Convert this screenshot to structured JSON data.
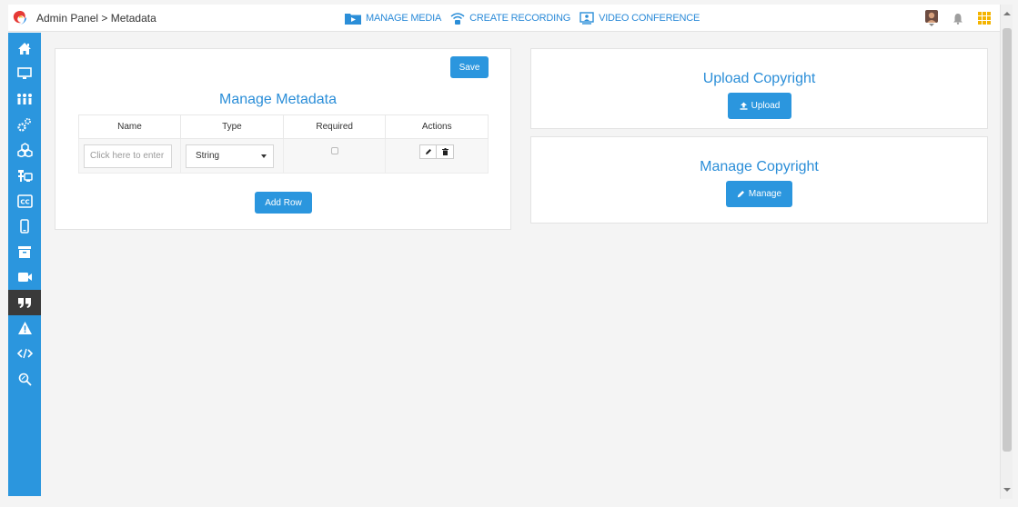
{
  "breadcrumb": {
    "text": "Admin Panel > Metadata"
  },
  "topnav": {
    "manage_media": "MANAGE MEDIA",
    "create_recording": "CREATE RECORDING",
    "video_conference": "VIDEO CONFERENCE"
  },
  "topright": {
    "icons": [
      "avatar",
      "bell-icon",
      "grid-icon"
    ]
  },
  "sidebar": {
    "items": [
      {
        "icon": "home-icon"
      },
      {
        "icon": "monitor-icon"
      },
      {
        "icon": "users-icon"
      },
      {
        "icon": "gears-icon"
      },
      {
        "icon": "cubes-icon"
      },
      {
        "icon": "resources-icon"
      },
      {
        "icon": "closed-caption-icon"
      },
      {
        "icon": "mobile-icon"
      },
      {
        "icon": "archive-icon"
      },
      {
        "icon": "video-camera-icon"
      },
      {
        "icon": "quote-icon",
        "active": true
      },
      {
        "icon": "warning-icon"
      },
      {
        "icon": "code-icon"
      },
      {
        "icon": "search-icon"
      }
    ]
  },
  "metadata": {
    "save_label": "Save",
    "title": "Manage Metadata",
    "columns": [
      "Name",
      "Type",
      "Required",
      "Actions"
    ],
    "rows": [
      {
        "name_placeholder": "Click here to enter",
        "type": "String",
        "required": false
      }
    ],
    "add_row_label": "Add Row"
  },
  "upload": {
    "title": "Upload Copyright",
    "button_label": "Upload"
  },
  "manage": {
    "title": "Manage Copyright",
    "button_label": "Manage"
  },
  "colors": {
    "accent": "#2b96de",
    "active_sidebar": "#3a3a3a",
    "title": "#2b8ed8"
  }
}
